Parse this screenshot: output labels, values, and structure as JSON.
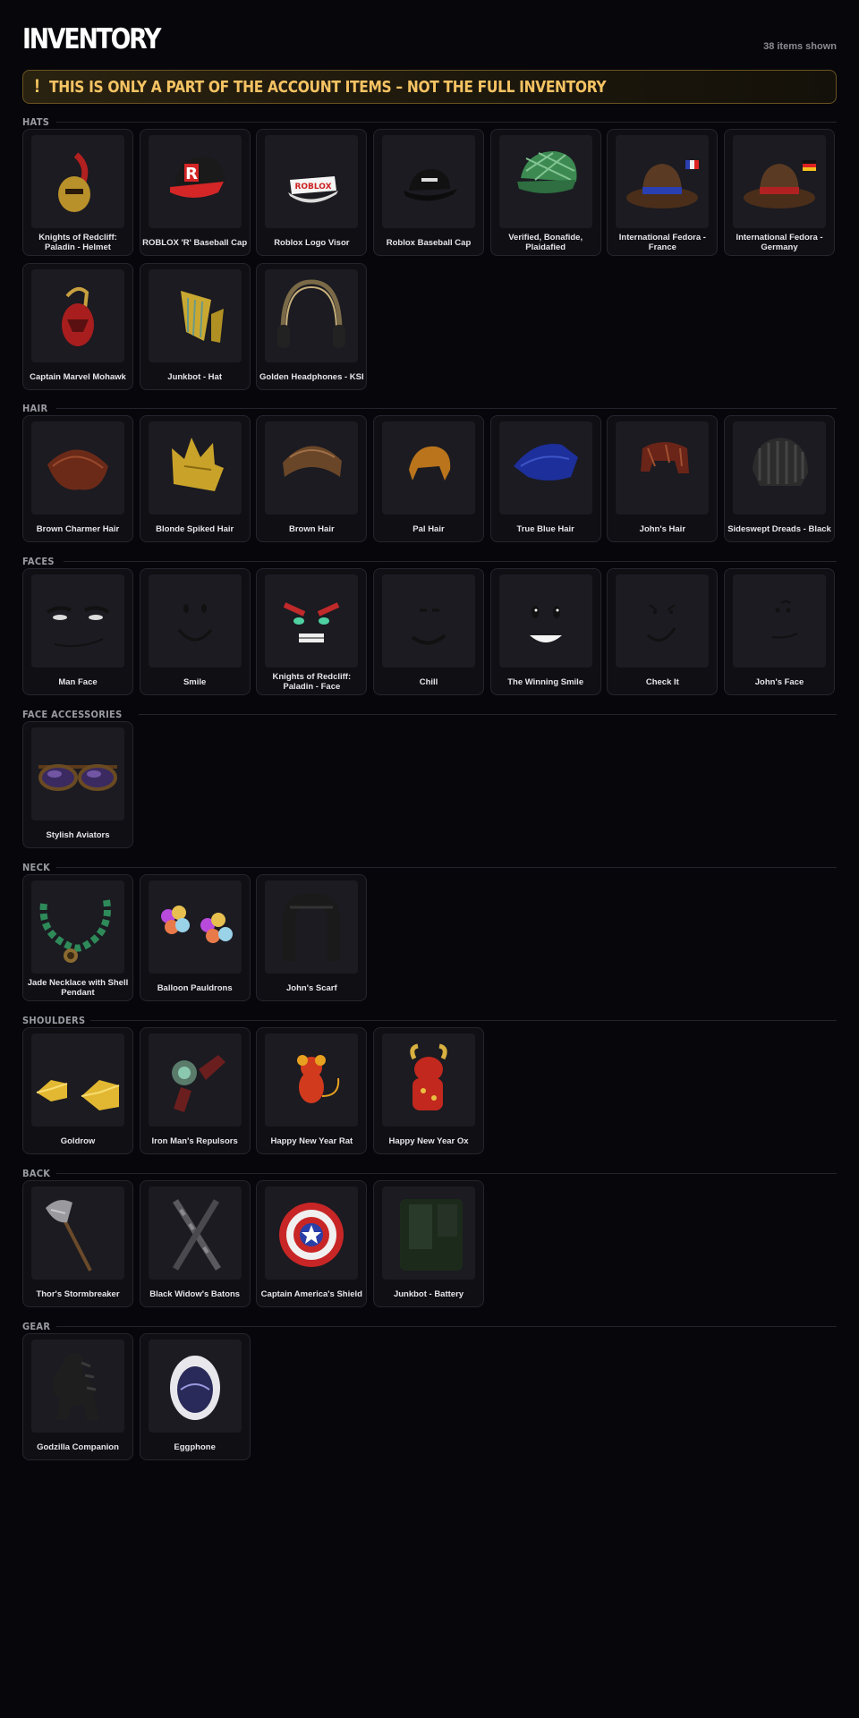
{
  "header": {
    "title": "INVENTORY",
    "count": "38 items shown"
  },
  "warning": {
    "icon": "!",
    "text": "THIS IS ONLY A PART OF THE ACCOUNT ITEMS – NOT THE FULL INVENTORY",
    "color": "#f5c363"
  },
  "sections": [
    {
      "title": "HATS",
      "items": [
        {
          "name": "Knights of Redcliff: Paladin - Helmet",
          "icon": "helmet-icon"
        },
        {
          "name": "ROBLOX 'R' Baseball Cap",
          "icon": "cap-r-icon"
        },
        {
          "name": "Roblox Logo Visor",
          "icon": "visor-icon"
        },
        {
          "name": "Roblox Baseball Cap",
          "icon": "cap-icon"
        },
        {
          "name": "Verified, Bonafide, Plaidafied",
          "icon": "plaid-cap-icon"
        },
        {
          "name": "International Fedora - France",
          "icon": "fedora-france-icon"
        },
        {
          "name": "International Fedora - Germany",
          "icon": "fedora-germany-icon"
        },
        {
          "name": "Captain Marvel Mohawk",
          "icon": "mohawk-icon"
        },
        {
          "name": "Junkbot - Hat",
          "icon": "junkbot-hat-icon"
        },
        {
          "name": "Golden Headphones - KSI",
          "icon": "headphones-icon"
        }
      ]
    },
    {
      "title": "HAIR",
      "items": [
        {
          "name": "Brown Charmer Hair",
          "icon": "hair-icon"
        },
        {
          "name": "Blonde Spiked Hair",
          "icon": "hair-icon"
        },
        {
          "name": "Brown Hair",
          "icon": "hair-icon"
        },
        {
          "name": "Pal Hair",
          "icon": "hair-icon"
        },
        {
          "name": "True Blue Hair",
          "icon": "hair-icon"
        },
        {
          "name": "John's Hair",
          "icon": "hair-icon"
        },
        {
          "name": "Sideswept Dreads - Black",
          "icon": "hair-icon"
        }
      ]
    },
    {
      "title": "FACES",
      "items": [
        {
          "name": "Man Face",
          "icon": "face-icon"
        },
        {
          "name": "Smile",
          "icon": "face-icon"
        },
        {
          "name": "Knights of Redcliff: Paladin - Face",
          "icon": "face-icon"
        },
        {
          "name": "Chill",
          "icon": "face-icon"
        },
        {
          "name": "The Winning Smile",
          "icon": "face-icon"
        },
        {
          "name": "Check It",
          "icon": "face-icon"
        },
        {
          "name": "John's Face",
          "icon": "face-icon"
        }
      ]
    },
    {
      "title": "FACE ACCESSORIES",
      "items": [
        {
          "name": "Stylish Aviators",
          "icon": "sunglasses-icon"
        }
      ]
    },
    {
      "title": "NECK",
      "items": [
        {
          "name": "Jade Necklace with Shell Pendant",
          "icon": "necklace-icon"
        },
        {
          "name": "Balloon Pauldrons",
          "icon": "balloons-icon"
        },
        {
          "name": "John's Scarf",
          "icon": "scarf-icon"
        }
      ]
    },
    {
      "title": "SHOULDERS",
      "items": [
        {
          "name": "Goldrow",
          "icon": "gold-bars-icon"
        },
        {
          "name": "Iron Man's Repulsors",
          "icon": "repulsors-icon"
        },
        {
          "name": "Happy New Year Rat",
          "icon": "rat-icon"
        },
        {
          "name": "Happy New Year Ox",
          "icon": "ox-icon"
        }
      ]
    },
    {
      "title": "BACK",
      "items": [
        {
          "name": "Thor's Stormbreaker",
          "icon": "axe-icon"
        },
        {
          "name": "Black Widow's Batons",
          "icon": "batons-icon"
        },
        {
          "name": "Captain America's Shield",
          "icon": "shield-icon"
        },
        {
          "name": "Junkbot - Battery",
          "icon": "battery-icon"
        }
      ]
    },
    {
      "title": "GEAR",
      "items": [
        {
          "name": "Godzilla Companion",
          "icon": "godzilla-icon"
        },
        {
          "name": "Eggphone",
          "icon": "eggphone-icon"
        }
      ]
    }
  ]
}
